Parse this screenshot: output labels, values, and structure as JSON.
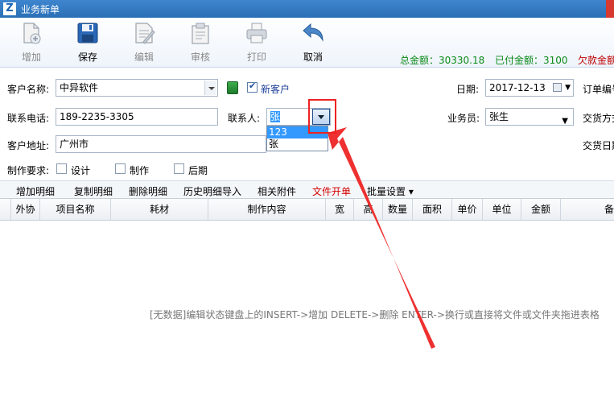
{
  "window": {
    "title": "业务新单",
    "app_icon": "Z"
  },
  "toolbar": {
    "add": "增加",
    "save": "保存",
    "edit": "编辑",
    "review": "审核",
    "print": "打印",
    "cancel": "取消"
  },
  "totals": {
    "total": "总金额：30330.18",
    "paid": "已付金额：3100",
    "owed": "欠款金额"
  },
  "form": {
    "customer_label": "客户名称:",
    "customer_value": "中异软件",
    "new_customer_label": "新客户",
    "new_customer_checked": true,
    "date_label": "日期:",
    "date_value": "2017-12-13",
    "order_no_label": "订单编号",
    "phone_label": "联系电话:",
    "phone_value": "189-2235-3305",
    "contact_label": "联系人:",
    "contact_value": "张",
    "salesperson_label": "业务员:",
    "salesperson_value": "张生",
    "delivery_method_label": "交货方式",
    "address_label": "客户地址:",
    "address_value": "广州市",
    "delivery_date_label": "交货日期",
    "production_req_label": "制作要求:",
    "req_design": "设计",
    "req_make": "制作",
    "req_post": "后期"
  },
  "contact_dropdown": {
    "options": [
      "123",
      "张"
    ],
    "selected_index": 0
  },
  "detail_toolbar": {
    "add_detail": "增加明细",
    "copy_detail": "复制明细",
    "delete_detail": "删除明细",
    "import_history": "历史明细导入",
    "attachments": "相关附件",
    "file_order": "文件开单",
    "batch_settings": "批量设置 ▾"
  },
  "grid": {
    "columns": [
      "外协",
      "项目名称",
      "耗材",
      "制作内容",
      "宽",
      "高",
      "数量",
      "面积",
      "单价",
      "单位",
      "金额",
      "备"
    ],
    "empty_hint": "[无数据]编辑状态键盘上的INSERT->增加 DELETE->删除 ENTER->换行或直接将文件或文件夹拖进表格"
  },
  "colors": {
    "accent_red": "#ee2222",
    "totals_green": "#0b8a18",
    "title_blue": "#2a6fb6"
  }
}
